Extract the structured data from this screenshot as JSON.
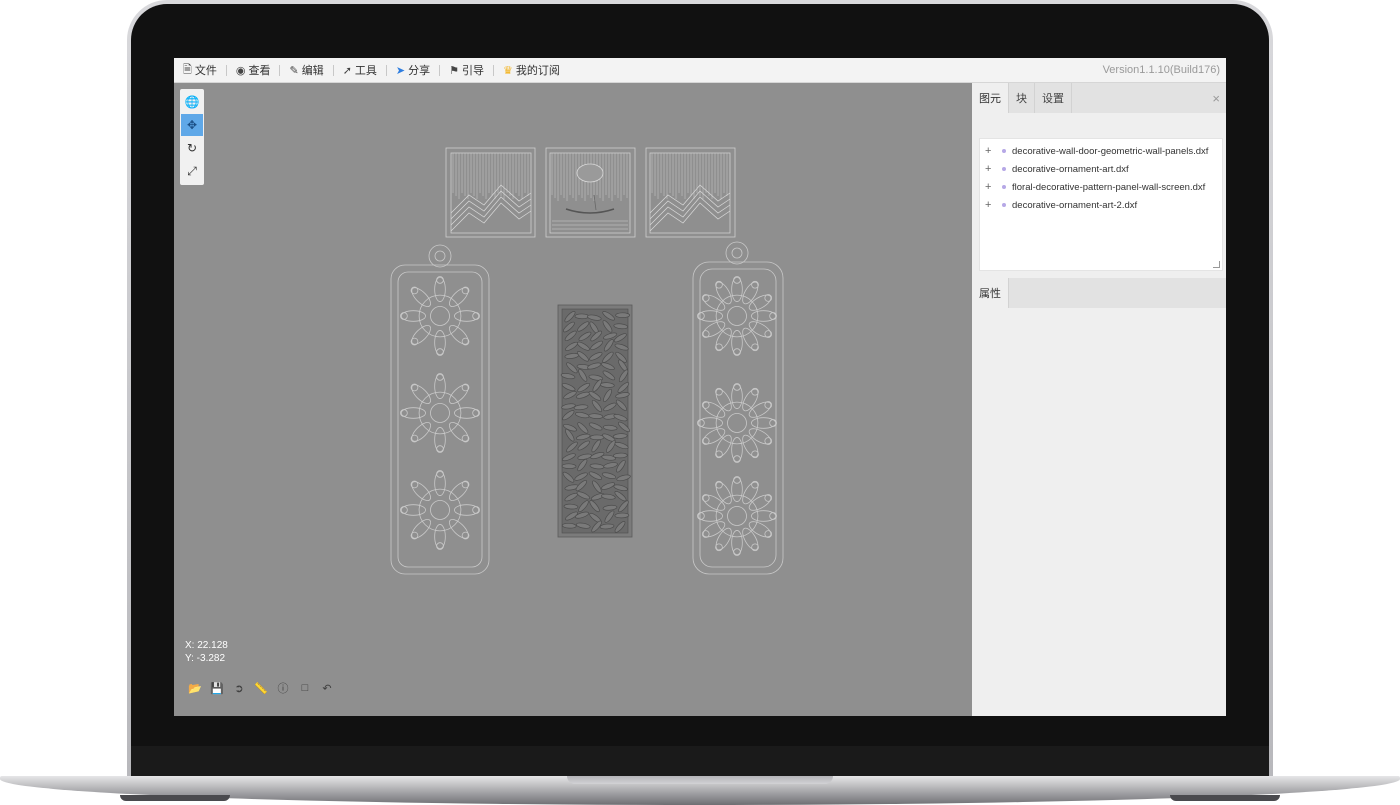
{
  "menu": {
    "items": [
      {
        "label": "文件",
        "icon": "file-icon"
      },
      {
        "label": "查看",
        "icon": "eye-icon"
      },
      {
        "label": "编辑",
        "icon": "edit-icon"
      },
      {
        "label": "工具",
        "icon": "wrench-icon"
      },
      {
        "label": "分享",
        "icon": "share-icon"
      },
      {
        "label": "引导",
        "icon": "guide-icon"
      },
      {
        "label": "我的订阅",
        "icon": "crown-icon"
      }
    ],
    "version": "Version1.1.10(Build176)"
  },
  "toolbox": [
    "globe-icon",
    "move-icon",
    "rotate-icon",
    "fit-screen-icon"
  ],
  "coords": {
    "x": "X: 22.128",
    "y": "Y: -3.282"
  },
  "bottom_tools": [
    "open-folder-icon",
    "save-icon",
    "export-icon",
    "ruler-icon",
    "info-icon",
    "select-box-icon",
    "undo-icon"
  ],
  "panel": {
    "tabs": [
      "图元",
      "块",
      "设置"
    ],
    "close": "×",
    "layers": [
      "decorative-wall-door-geometric-wall-panels.dxf",
      "decorative-ornament-art.dxf",
      "floral-decorative-pattern-panel-wall-screen.dxf",
      "decorative-ornament-art-2.dxf"
    ],
    "props_tab": "属性"
  },
  "colors": {
    "accent": "#5fa8e8",
    "canvas_bg": "#8f8f8f",
    "line": "#c9c9c9",
    "dark_fill": "#6b6b6b"
  }
}
